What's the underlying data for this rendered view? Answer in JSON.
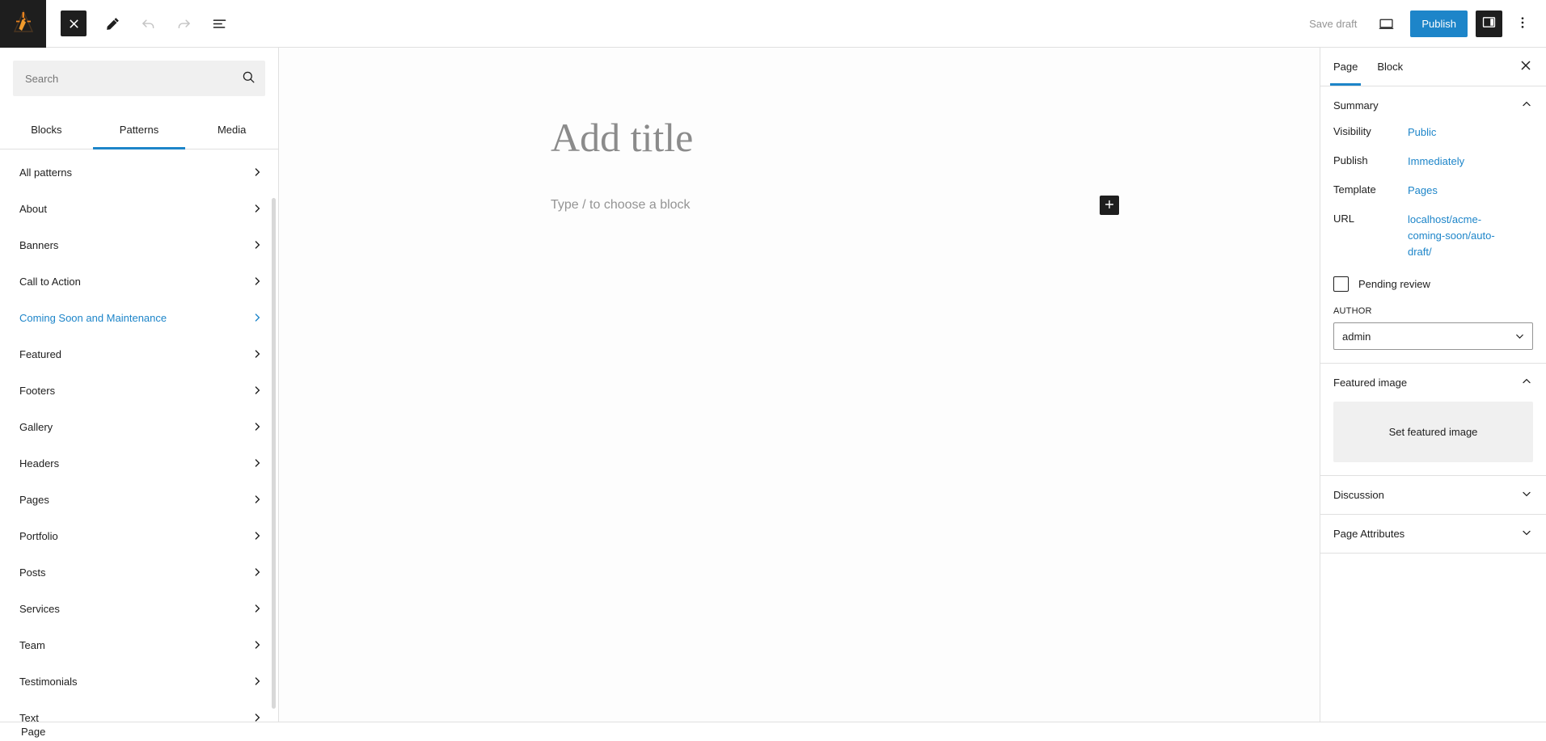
{
  "topbar": {
    "logo_icon": "wordpress-site-logo-icon",
    "close_icon": "close-x-icon",
    "edit_icon": "pencil-edit-icon",
    "undo_icon": "undo-arrow-icon",
    "redo_icon": "redo-arrow-icon",
    "details_icon": "document-overview-list-icon",
    "save_draft_label": "Save draft",
    "preview_icon": "desktop-preview-icon",
    "publish_label": "Publish",
    "settings_toggle_icon": "settings-sidebar-panel-icon",
    "kebab_icon": "more-options-vertical-dots-icon",
    "accent_blue": "#1d85c9",
    "dark": "#1e1e1e"
  },
  "inserter": {
    "search": {
      "value": "",
      "placeholder": "Search",
      "icon": "search-magnifier-icon"
    },
    "tabs": [
      {
        "label": "Blocks",
        "active": false
      },
      {
        "label": "Patterns",
        "active": true
      },
      {
        "label": "Media",
        "active": false
      }
    ],
    "categories": [
      {
        "label": "All patterns",
        "selected": false
      },
      {
        "label": "About",
        "selected": false
      },
      {
        "label": "Banners",
        "selected": false
      },
      {
        "label": "Call to Action",
        "selected": false
      },
      {
        "label": "Coming Soon and Maintenance",
        "selected": true
      },
      {
        "label": "Featured",
        "selected": false
      },
      {
        "label": "Footers",
        "selected": false
      },
      {
        "label": "Gallery",
        "selected": false
      },
      {
        "label": "Headers",
        "selected": false
      },
      {
        "label": "Pages",
        "selected": false
      },
      {
        "label": "Portfolio",
        "selected": false
      },
      {
        "label": "Posts",
        "selected": false
      },
      {
        "label": "Services",
        "selected": false
      },
      {
        "label": "Team",
        "selected": false
      },
      {
        "label": "Testimonials",
        "selected": false
      },
      {
        "label": "Text",
        "selected": false
      }
    ],
    "chevron_icon": "chevron-right-icon"
  },
  "canvas": {
    "title_placeholder": "Add title",
    "block_placeholder": "Type / to choose a block",
    "add_block_icon": "plus-add-block-icon"
  },
  "settings": {
    "tabs": [
      {
        "label": "Page",
        "active": true
      },
      {
        "label": "Block",
        "active": false
      }
    ],
    "close_icon": "close-x-icon",
    "summary": {
      "title": "Summary",
      "collapse_icon": "chevron-up-icon",
      "rows": [
        {
          "label": "Visibility",
          "value": "Public"
        },
        {
          "label": "Publish",
          "value": "Immediately"
        },
        {
          "label": "Template",
          "value": "Pages"
        },
        {
          "label": "URL",
          "value": "localhost/acme-coming-soon/auto-draft/"
        }
      ],
      "pending_review_label": "Pending review",
      "pending_review_checked": false,
      "author_label": "AUTHOR",
      "author_value": "admin",
      "author_options": [
        "admin"
      ],
      "select_chevron_icon": "chevron-down-icon"
    },
    "featured_image": {
      "title": "Featured image",
      "collapse_icon": "chevron-up-icon",
      "set_label": "Set featured image"
    },
    "discussion": {
      "title": "Discussion",
      "expand_icon": "chevron-down-icon"
    },
    "page_attributes": {
      "title": "Page Attributes",
      "expand_icon": "chevron-down-icon"
    }
  },
  "statusbar": {
    "label": "Page"
  }
}
